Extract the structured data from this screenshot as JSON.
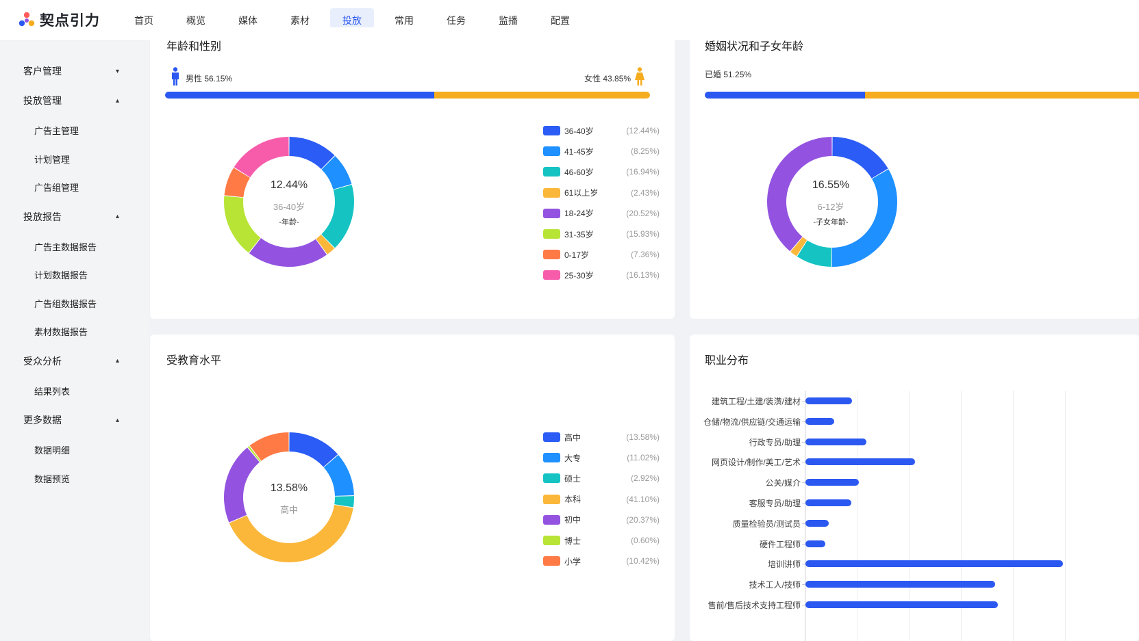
{
  "brand": {
    "name": "契点引力"
  },
  "nav": [
    {
      "label": "首页"
    },
    {
      "label": "概览"
    },
    {
      "label": "媒体"
    },
    {
      "label": "素材"
    },
    {
      "label": "投放",
      "active": true
    },
    {
      "label": "常用"
    },
    {
      "label": "任务"
    },
    {
      "label": "监播"
    },
    {
      "label": "配置"
    }
  ],
  "sidebar": {
    "groups": [
      {
        "label": "客户管理",
        "chevron": "down",
        "items": []
      },
      {
        "label": "投放管理",
        "chevron": "up",
        "items": [
          "广告主管理",
          "计划管理",
          "广告组管理"
        ]
      },
      {
        "label": "投放报告",
        "chevron": "up",
        "items": [
          "广告主数据报告",
          "计划数据报告",
          "广告组数据报告",
          "素材数据报告"
        ]
      },
      {
        "label": "受众分析",
        "chevron": "up",
        "items": [
          "结果列表"
        ]
      },
      {
        "label": "更多数据",
        "chevron": "up",
        "items": [
          "数据明细",
          "数据预览"
        ]
      }
    ]
  },
  "cards": {
    "age_gender": {
      "title": "年龄和性别",
      "male_label": "男性 56.15%",
      "female_label": "女性 43.85%",
      "male_share": 56.15,
      "center": {
        "pct": "12.44%",
        "label": "36-40岁",
        "sub": "-年龄-"
      }
    },
    "marital": {
      "title": "婚姻状况和子女年龄",
      "married_label": "已婚 51.25%",
      "married_share": 51.25,
      "center": {
        "pct": "16.55%",
        "label": "6-12岁",
        "sub": "-子女年龄-"
      }
    },
    "education": {
      "title": "受教育水平",
      "center": {
        "pct": "13.58%",
        "label": "高中"
      }
    },
    "occupation": {
      "title": "职业分布"
    }
  },
  "colors": {
    "male": "#2b58f0",
    "female": "#f5ad1f",
    "accent": "#2e5bf0"
  },
  "chart_data": [
    {
      "type": "pie",
      "title": "年龄和性别",
      "categories": [
        "36-40岁",
        "41-45岁",
        "46-60岁",
        "61以上岁",
        "18-24岁",
        "31-35岁",
        "0-17岁",
        "25-30岁"
      ],
      "values": [
        12.44,
        8.25,
        16.94,
        2.43,
        20.52,
        15.93,
        7.36,
        16.13
      ],
      "pct_labels": [
        "(12.44%)",
        "(8.25%)",
        "(16.94%)",
        "(2.43%)",
        "(20.52%)",
        "(15.93%)",
        "(7.36%)",
        "(16.13%)"
      ],
      "colors": [
        "#2b5cf5",
        "#1e90ff",
        "#15c3c3",
        "#fbb73a",
        "#9353e0",
        "#b8e436",
        "#ff7a45",
        "#f75cab"
      ]
    },
    {
      "type": "pie",
      "title": "婚姻状况和子女年龄",
      "categories": [
        "6-12岁",
        "",
        "",
        "",
        ""
      ],
      "values": [
        16.55,
        33.6,
        9.0,
        2.0,
        38.85
      ],
      "colors": [
        "#2b5cf5",
        "#1e90ff",
        "#15c3c3",
        "#fbb73a",
        "#9353e0"
      ]
    },
    {
      "type": "pie",
      "title": "受教育水平",
      "categories": [
        "高中",
        "大专",
        "硕士",
        "本科",
        "初中",
        "博士",
        "小学"
      ],
      "values": [
        13.58,
        11.02,
        2.92,
        41.1,
        20.37,
        0.6,
        10.42
      ],
      "pct_labels": [
        "(13.58%)",
        "(11.02%)",
        "(2.92%)",
        "(41.10%)",
        "(20.37%)",
        "(0.60%)",
        "(10.42%)"
      ],
      "colors": [
        "#2b5cf5",
        "#1e90ff",
        "#15c3c3",
        "#fbb73a",
        "#9353e0",
        "#b8e436",
        "#ff7a45"
      ]
    },
    {
      "type": "bar",
      "orientation": "horizontal",
      "title": "职业分布",
      "categories": [
        "建筑工程/土建/装潢/建材",
        "仓储/物流/供应链/交通运输",
        "行政专员/助理",
        "网页设计/制作/美工/艺术",
        "公关/媒介",
        "客服专员/助理",
        "质量检验员/测试员",
        "硬件工程师",
        "培训讲师",
        "技术工人/技师",
        "售前/售后技术支持工程师"
      ],
      "values": [
        0.9,
        0.55,
        1.17,
        2.1,
        1.03,
        0.88,
        0.45,
        0.38,
        4.95,
        3.65,
        3.7
      ],
      "grid": true
    }
  ]
}
